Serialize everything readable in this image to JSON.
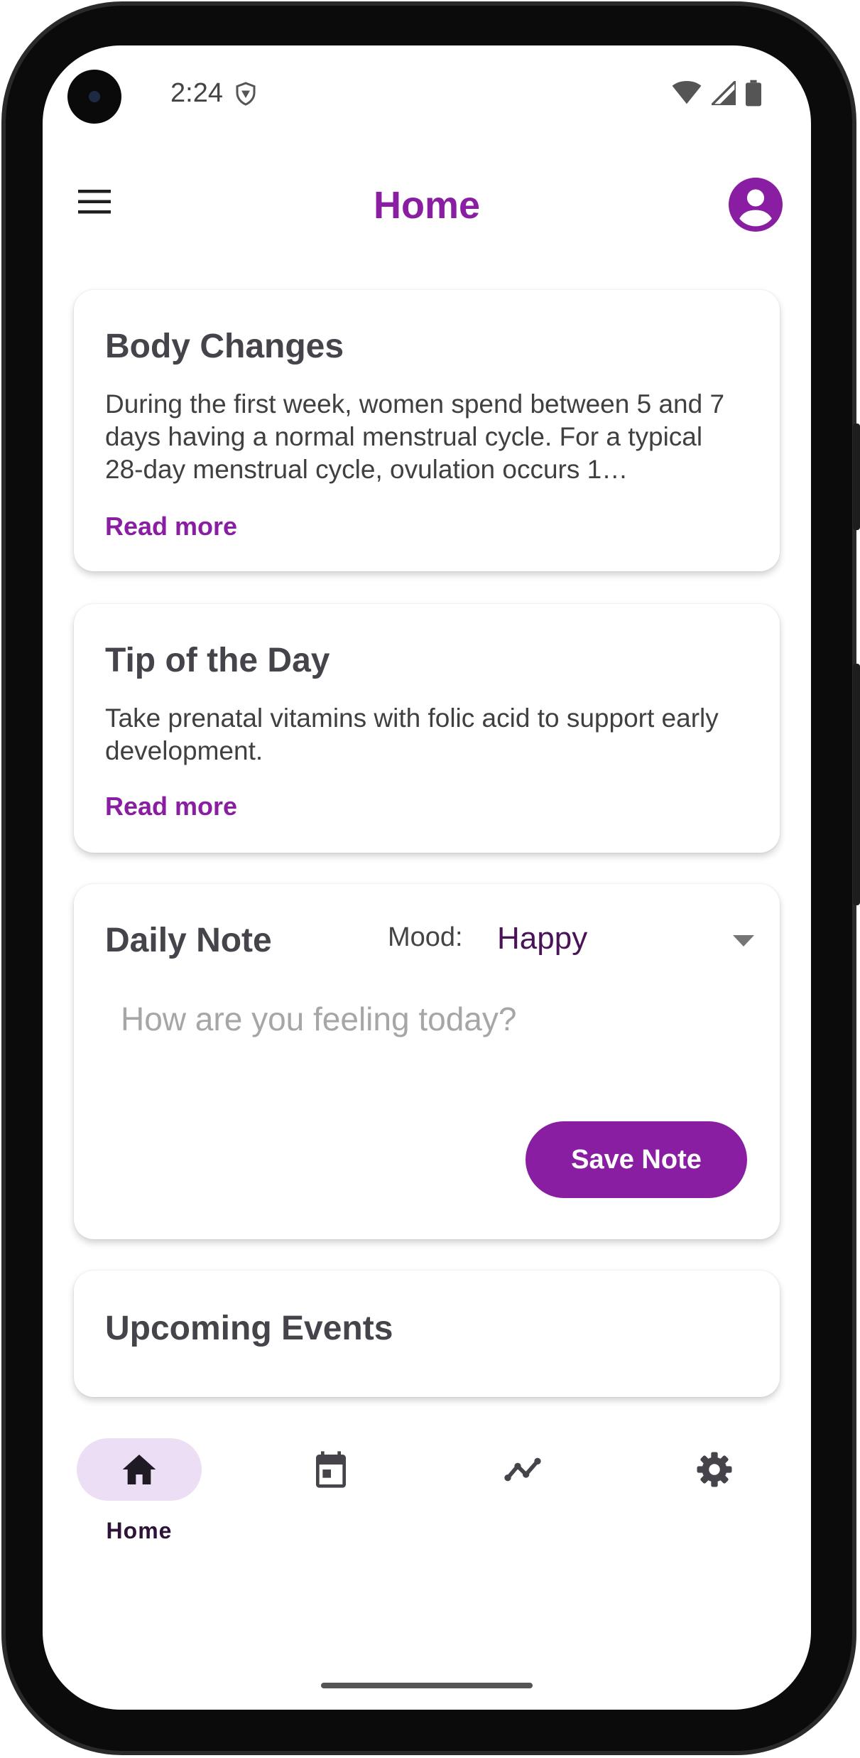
{
  "status_bar": {
    "time": "2:24"
  },
  "header": {
    "title": "Home"
  },
  "body_changes": {
    "title": "Body Changes",
    "text": "During the first week, women spend between 5 and 7 days having a normal menstrual cycle. For a typical 28-day menstrual cycle, ovulation occurs 1…",
    "read_more": "Read more"
  },
  "tip_of_day": {
    "title": "Tip of the Day",
    "text": "Take prenatal vitamins with folic acid to support early development.",
    "read_more": "Read more"
  },
  "daily_note": {
    "title": "Daily Note",
    "mood_label": "Mood:",
    "mood_value": "Happy",
    "input_placeholder": "How are you feeling today?",
    "input_value": "",
    "save_label": "Save Note"
  },
  "upcoming_events": {
    "title": "Upcoming Events"
  },
  "bottom_nav": {
    "items": [
      {
        "label": "Home",
        "icon": "home-icon",
        "active": true
      },
      {
        "label": "",
        "icon": "calendar-icon",
        "active": false
      },
      {
        "label": "",
        "icon": "trend-icon",
        "active": false
      },
      {
        "label": "",
        "icon": "gear-icon",
        "active": false
      }
    ]
  },
  "colors": {
    "accent": "#8a1ea3",
    "active_pill": "#ecdff5",
    "card_title": "#46434b"
  }
}
